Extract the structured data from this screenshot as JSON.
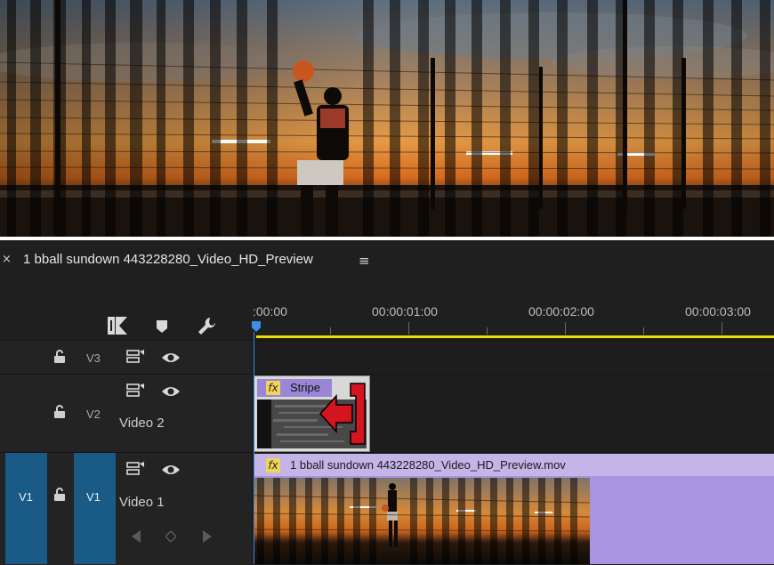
{
  "sequence": {
    "title": "1 bball sundown 443228280_Video_HD_Preview",
    "close_icon": "×",
    "menu_icon": "≡"
  },
  "ruler": {
    "timecodes": [
      ":00:00",
      "00:00:01:00",
      "00:00:02:00",
      "00:00:03:00"
    ]
  },
  "tracks": {
    "v3": {
      "label": "V3"
    },
    "v2": {
      "label": "V2",
      "name": "Video 2"
    },
    "v1": {
      "source": "V1",
      "label": "V1",
      "name": "Video 1"
    }
  },
  "clips": {
    "stripe": {
      "fx": "fx",
      "title": "Stripe"
    },
    "main": {
      "fx": "fx",
      "title": "1 bball sundown 443228280_Video_HD_Preview.mov"
    }
  },
  "colors": {
    "accent_blue": "#3a8ee6",
    "track_blue": "#1a5a86",
    "clip_purple": "#a894e0",
    "work_area": "#e8e000"
  }
}
